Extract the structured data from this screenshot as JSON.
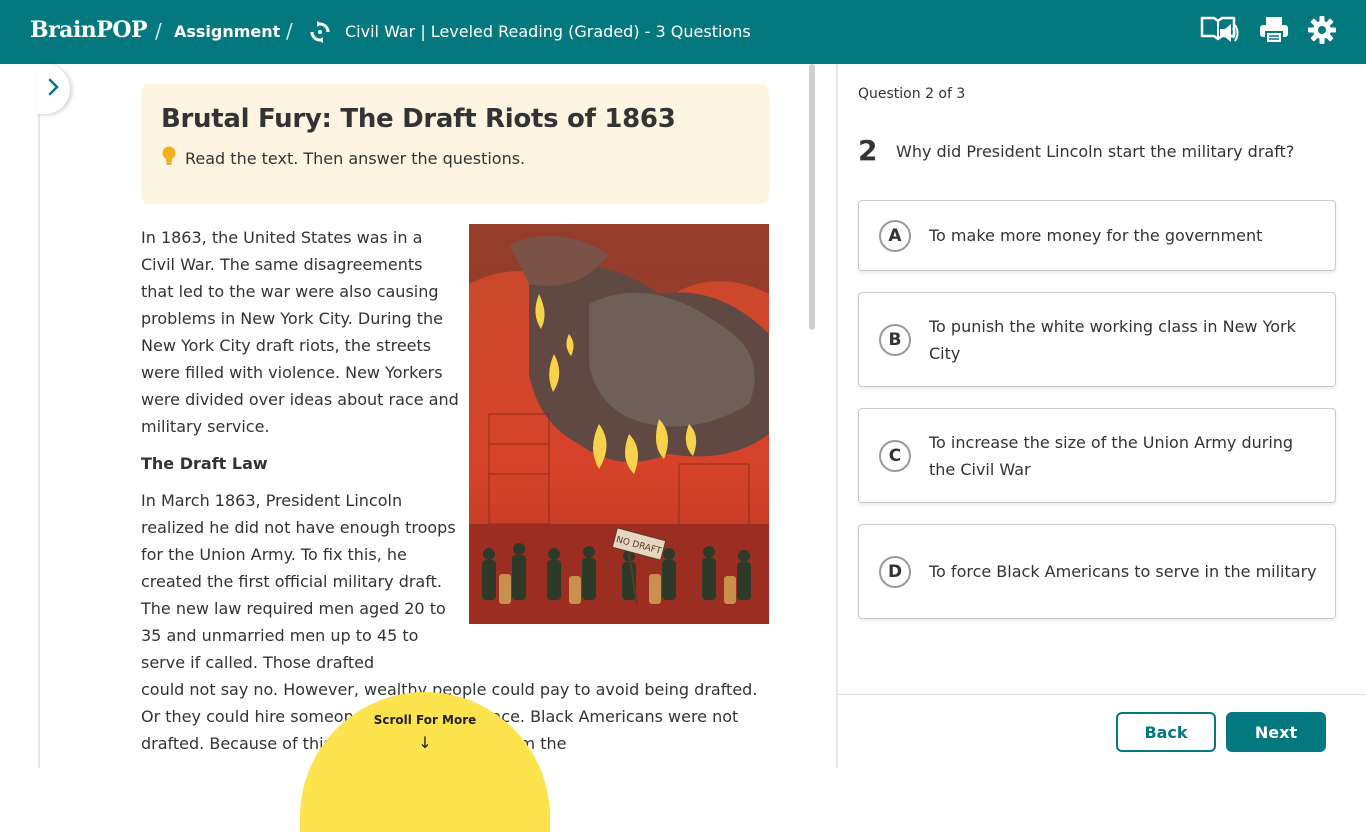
{
  "header": {
    "logo": "BrainPOP",
    "separator": "/",
    "breadcrumb_assignment": "Assignment",
    "title": "Civil War | Leveled Reading (Graded) - 3 Questions",
    "icons": [
      "read-aloud-icon",
      "print-icon",
      "settings-gear-icon"
    ]
  },
  "reading": {
    "title": "Brutal Fury: The Draft Riots of 1863",
    "instruction": "Read the text. Then answer the questions.",
    "image_sign_text": "NO DRAFT",
    "paragraph1": "In 1863, the United States was in a Civil War. The same disagreements that led to the war were also causing problems in New York City. During the New York City draft riots, the streets were filled with violence. New Yorkers were divided over ideas about race and military service.",
    "subheading": "The Draft Law",
    "paragraph2_a": "In March 1863, President Lincoln realized he did not have enough troops for the Union Army. To fix this, he created the first official military draft. The new law required men aged 20 to 35 and unmarried men up to 45 to serve if called. Those drafted",
    "paragraph2_b": "could not say no. However, wealthy people could pay to avoid being drafted. Or they could hire someone to go in their place. Black Americans were not drafted. Because of this, they were accused from the"
  },
  "scroll_prompt": {
    "label": "Scroll For More",
    "arrow": "↓"
  },
  "question": {
    "counter": "Question 2 of 3",
    "number": "2",
    "text": "Why did President Lincoln start the military draft?",
    "options": [
      {
        "letter": "A",
        "text": "To make more money for the government"
      },
      {
        "letter": "B",
        "text": "To punish the white working class in New York City"
      },
      {
        "letter": "C",
        "text": "To increase the size of the Union Army during the Civil War"
      },
      {
        "letter": "D",
        "text": "To force Black Americans to serve in the military"
      }
    ]
  },
  "nav": {
    "back_label": "Back",
    "next_label": "Next"
  },
  "colors": {
    "brand_teal": "#04787f",
    "title_card_bg": "#fdf5e2",
    "scroll_prompt_bg": "#fde34d"
  }
}
